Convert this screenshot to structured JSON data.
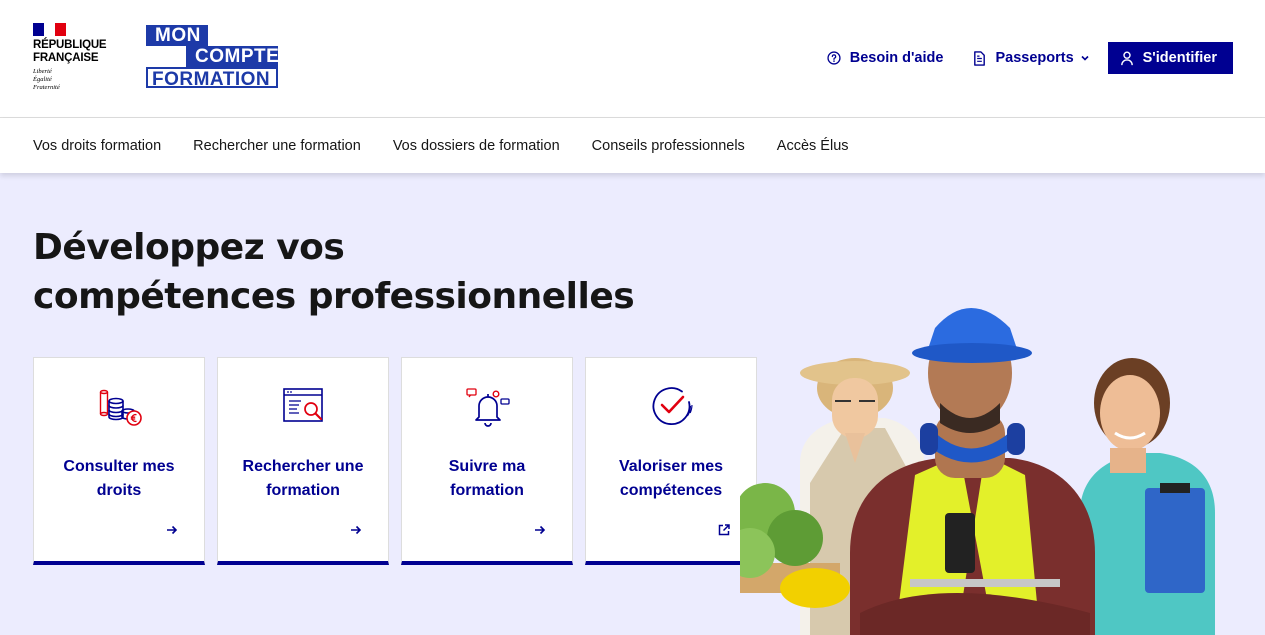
{
  "header": {
    "rf_logo": {
      "name_line1": "RÉPUBLIQUE",
      "name_line2": "FRANÇAISE",
      "motto1": "Liberté",
      "motto2": "Égalité",
      "motto3": "Fraternité"
    },
    "brand_logo": {
      "line1": "MON",
      "line2": "COMPTE",
      "line3": "FORMATION"
    },
    "help_label": "Besoin d'aide",
    "passports_label": "Passeports",
    "login_label": "S'identifier"
  },
  "nav": {
    "items": [
      {
        "label": "Vos droits formation"
      },
      {
        "label": "Rechercher une formation"
      },
      {
        "label": "Vos dossiers de formation"
      },
      {
        "label": "Conseils professionnels"
      },
      {
        "label": "Accès Élus"
      }
    ]
  },
  "hero": {
    "title_line1": "Développez vos",
    "title_line2": "compétences professionnelles",
    "cards": [
      {
        "label": "Consulter mes droits",
        "icon": "coins-euro-icon",
        "action_icon": "arrow-right-icon"
      },
      {
        "label": "Rechercher une formation",
        "icon": "search-window-icon",
        "action_icon": "arrow-right-icon"
      },
      {
        "label": "Suivre ma formation",
        "icon": "notification-bell-icon",
        "action_icon": "arrow-right-icon"
      },
      {
        "label": "Valoriser mes compétences",
        "icon": "check-circle-icon",
        "action_icon": "external-link-icon"
      }
    ],
    "image": "workers-photo"
  },
  "colors": {
    "primary": "#000091",
    "accent_red": "#e1000f",
    "hero_bg": "#ececfe",
    "brand_blue": "#1d3aa8"
  }
}
